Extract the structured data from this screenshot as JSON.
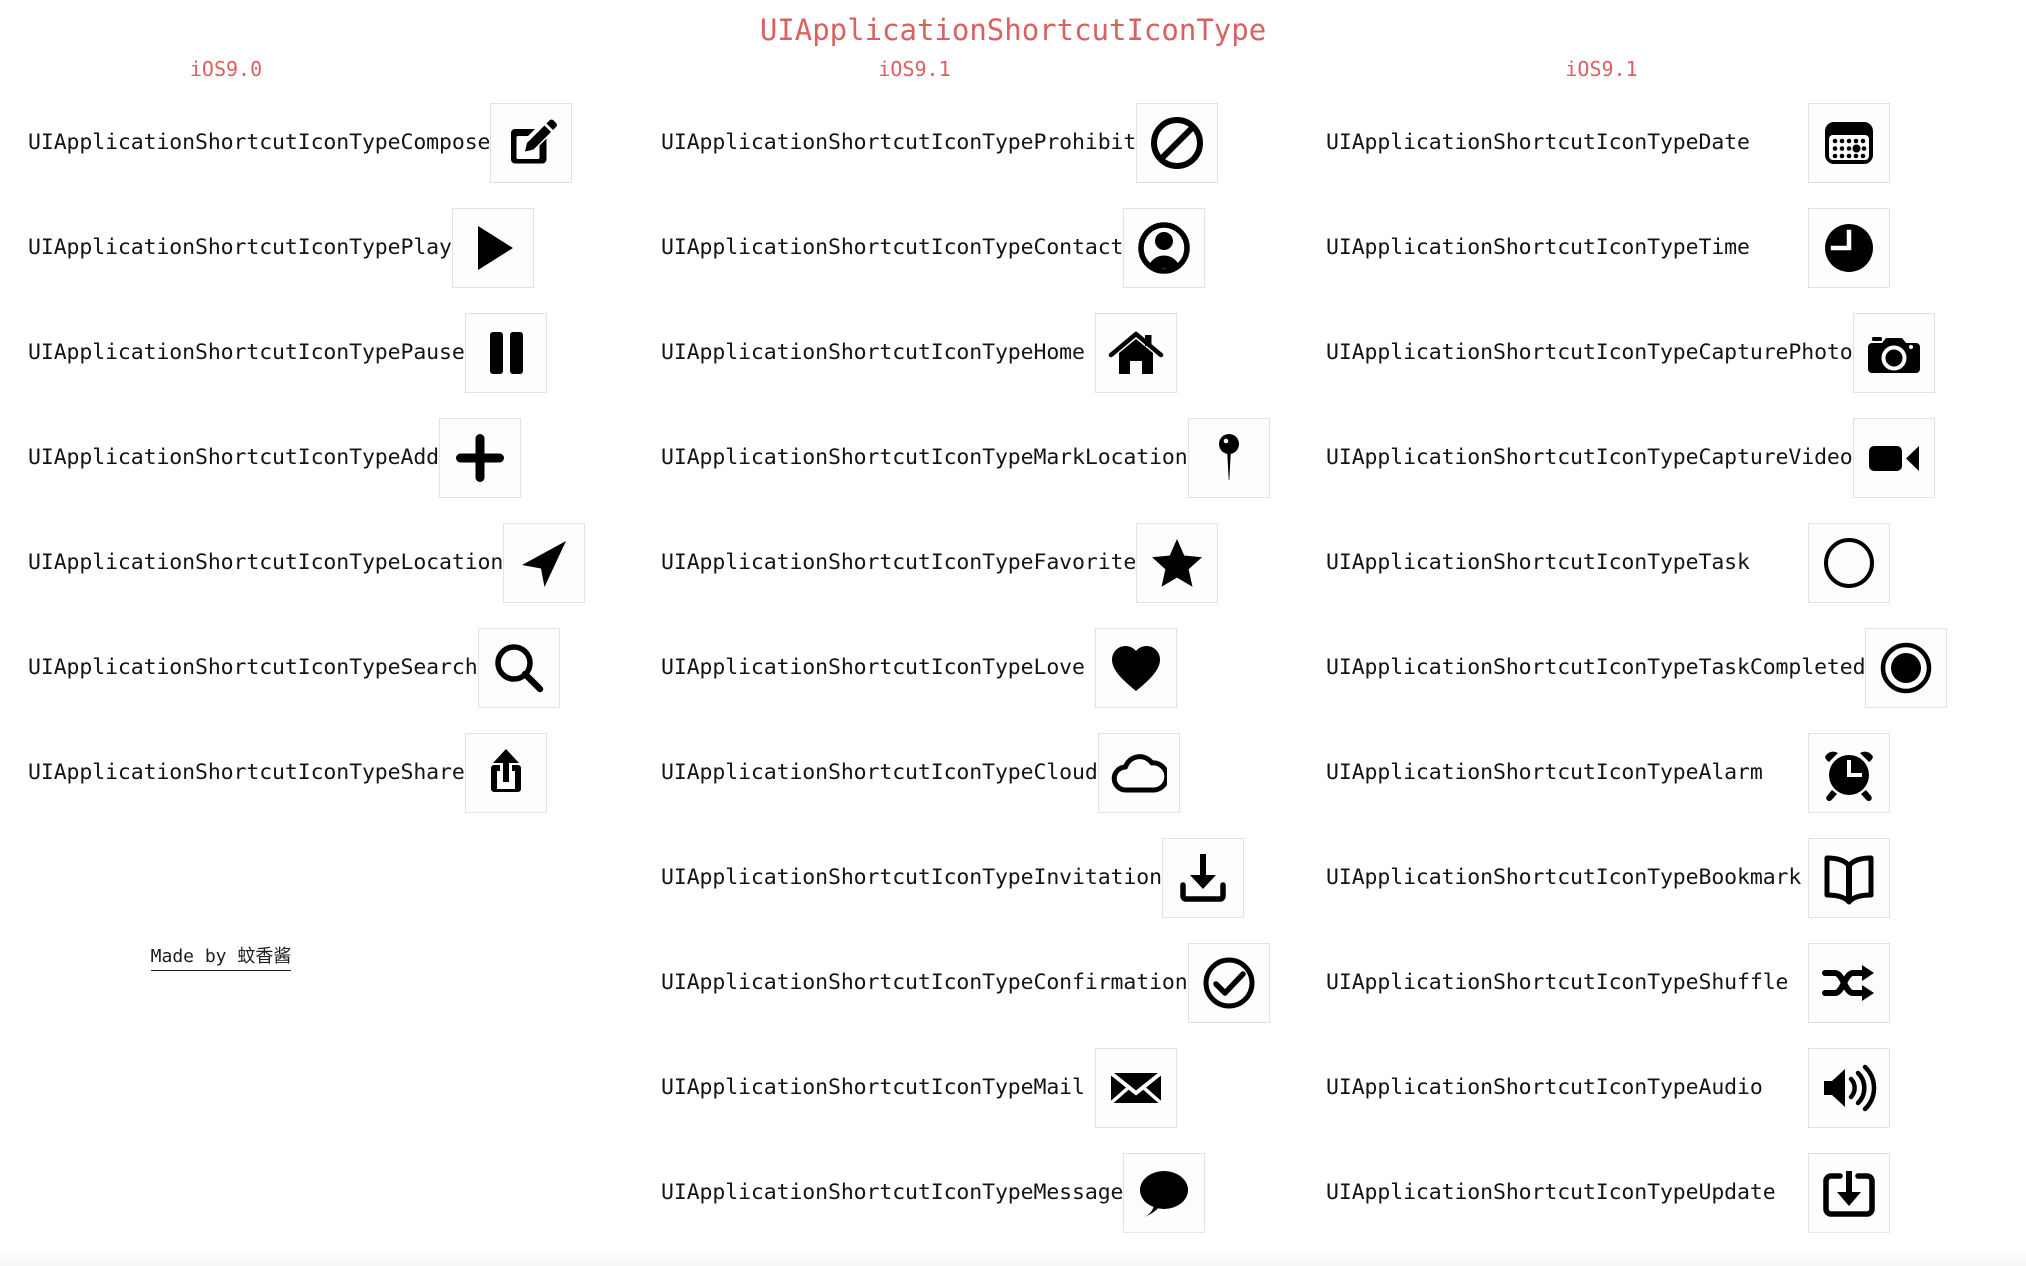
{
  "page": {
    "title": "UIApplicationShortcutIconType",
    "title_color": "#d9615f",
    "background": "#ffffff",
    "footer": "Made by 蚊香酱"
  },
  "columns": [
    {
      "header": "iOS9.0",
      "rows": [
        {
          "label": "UIApplicationShortcutIconTypeCompose",
          "icon": "compose-icon"
        },
        {
          "label": "UIApplicationShortcutIconTypePlay",
          "icon": "play-icon"
        },
        {
          "label": "UIApplicationShortcutIconTypePause",
          "icon": "pause-icon"
        },
        {
          "label": "UIApplicationShortcutIconTypeAdd",
          "icon": "add-icon"
        },
        {
          "label": "UIApplicationShortcutIconTypeLocation",
          "icon": "location-icon"
        },
        {
          "label": "UIApplicationShortcutIconTypeSearch",
          "icon": "search-icon"
        },
        {
          "label": "UIApplicationShortcutIconTypeShare",
          "icon": "share-icon"
        }
      ]
    },
    {
      "header": "iOS9.1",
      "rows": [
        {
          "label": "UIApplicationShortcutIconTypeProhibit",
          "icon": "prohibit-icon"
        },
        {
          "label": "UIApplicationShortcutIconTypeContact",
          "icon": "contact-icon"
        },
        {
          "label": "UIApplicationShortcutIconTypeHome",
          "icon": "home-icon"
        },
        {
          "label": "UIApplicationShortcutIconTypeMarkLocation",
          "icon": "mark-location-icon"
        },
        {
          "label": "UIApplicationShortcutIconTypeFavorite",
          "icon": "star-icon"
        },
        {
          "label": "UIApplicationShortcutIconTypeLove",
          "icon": "heart-icon"
        },
        {
          "label": "UIApplicationShortcutIconTypeCloud",
          "icon": "cloud-icon"
        },
        {
          "label": "UIApplicationShortcutIconTypeInvitation",
          "icon": "download-arrow-icon"
        },
        {
          "label": "UIApplicationShortcutIconTypeConfirmation",
          "icon": "check-circle-icon"
        },
        {
          "label": "UIApplicationShortcutIconTypeMail",
          "icon": "mail-icon"
        },
        {
          "label": "UIApplicationShortcutIconTypeMessage",
          "icon": "message-bubble-icon"
        }
      ]
    },
    {
      "header": "iOS9.1",
      "rows": [
        {
          "label": "UIApplicationShortcutIconTypeDate",
          "icon": "calendar-icon"
        },
        {
          "label": "UIApplicationShortcutIconTypeTime",
          "icon": "clock-icon"
        },
        {
          "label": "UIApplicationShortcutIconTypeCapturePhoto",
          "icon": "camera-icon"
        },
        {
          "label": "UIApplicationShortcutIconTypeCaptureVideo",
          "icon": "video-camera-icon"
        },
        {
          "label": "UIApplicationShortcutIconTypeTask",
          "icon": "circle-outline-icon"
        },
        {
          "label": "UIApplicationShortcutIconTypeTaskCompleted",
          "icon": "circle-filled-icon"
        },
        {
          "label": "UIApplicationShortcutIconTypeAlarm",
          "icon": "alarm-clock-icon"
        },
        {
          "label": "UIApplicationShortcutIconTypeBookmark",
          "icon": "book-icon"
        },
        {
          "label": "UIApplicationShortcutIconTypeShuffle",
          "icon": "shuffle-icon"
        },
        {
          "label": "UIApplicationShortcutIconTypeAudio",
          "icon": "speaker-icon"
        },
        {
          "label": "UIApplicationShortcutIconTypeUpdate",
          "icon": "update-icon"
        }
      ]
    }
  ]
}
